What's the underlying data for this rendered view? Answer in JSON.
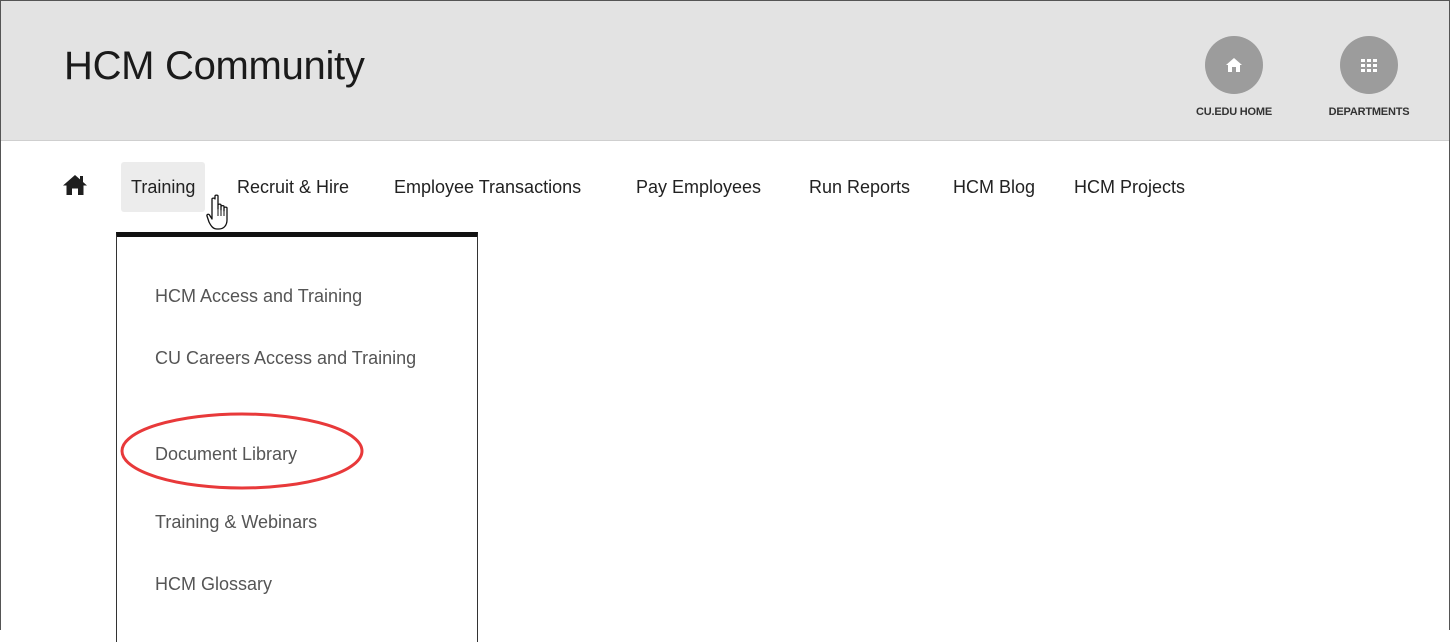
{
  "header": {
    "site_title": "HCM Community",
    "links": [
      {
        "label": "CU.EDU HOME",
        "icon": "home-icon"
      },
      {
        "label": "DEPARTMENTS",
        "icon": "grid-icon"
      }
    ]
  },
  "nav": {
    "home_icon": "home-icon",
    "items": [
      {
        "label": "Training",
        "active": true
      },
      {
        "label": "Recruit & Hire"
      },
      {
        "label": "Employee Transactions"
      },
      {
        "label": "Pay Employees"
      },
      {
        "label": "Run Reports"
      },
      {
        "label": "HCM Blog"
      },
      {
        "label": "HCM Projects"
      }
    ]
  },
  "dropdown": {
    "items": [
      {
        "label": "HCM Access and Training"
      },
      {
        "label": "CU Careers Access and Training"
      },
      {
        "label": "Document Library",
        "highlighted": true
      },
      {
        "label": "Training & Webinars"
      },
      {
        "label": "HCM Glossary"
      }
    ]
  },
  "colors": {
    "header_bg": "#e3e3e3",
    "circle_button": "#9c9c9c",
    "annotation_red": "#e8393a"
  },
  "cursor_icon": "hand-pointer-icon"
}
